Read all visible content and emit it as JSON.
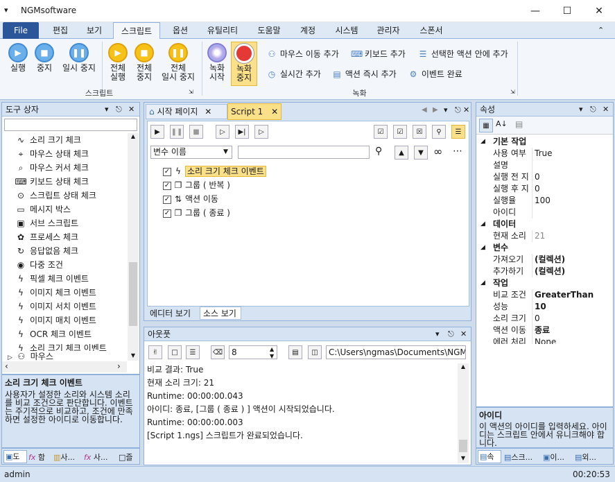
{
  "window": {
    "title": "NGMsoftware",
    "quick_access": "▾"
  },
  "tabs": [
    "File",
    "편집",
    "보기",
    "스크립트",
    "옵션",
    "유틸리티",
    "도움말",
    "계정",
    "시스템",
    "관리자",
    "스폰서"
  ],
  "ribbon": {
    "group_script": "스크립트",
    "group_record": "녹화",
    "run": "실행",
    "stop": "중지",
    "pause": "일시 중지",
    "all_run_1": "전체",
    "all_run_2": "실행",
    "all_stop_1": "전체",
    "all_stop_2": "중지",
    "all_pause_1": "전체",
    "all_pause_2": "일시 중지",
    "rec_start_1": "녹화",
    "rec_start_2": "시작",
    "rec_stop_1": "녹화",
    "rec_stop_2": "중지",
    "add_mouse_move": "마우스 이동 추가",
    "add_keyboard": "키보드 추가",
    "add_in_selected": "선택한 액션 안에 추가",
    "add_realtime": "실시간 추가",
    "add_action_now": "액션 즉시 추가",
    "event_complete": "이벤트 완료"
  },
  "toolbox": {
    "title": "도구 상자",
    "items": [
      {
        "icon": "∿",
        "label": "소리 크기 체크"
      },
      {
        "icon": "⌖",
        "label": "마우스 상태 체크"
      },
      {
        "icon": "⌕",
        "label": "마우스 커서 체크"
      },
      {
        "icon": "⌨",
        "label": "키보드 상태 체크"
      },
      {
        "icon": "⊙",
        "label": "스크립트 상태 체크"
      },
      {
        "icon": "▭",
        "label": "메시지 박스"
      },
      {
        "icon": "▣",
        "label": "서브 스크립트"
      },
      {
        "icon": "✿",
        "label": "프로세스 체크"
      },
      {
        "icon": "↻",
        "label": "응답없음 체크"
      },
      {
        "icon": "◉",
        "label": "다중 조건"
      },
      {
        "icon": "ϟ",
        "label": "픽셀 체크 이벤트"
      },
      {
        "icon": "ϟ",
        "label": "이미지 체크 이벤트"
      },
      {
        "icon": "ϟ",
        "label": "이미지 서치 이벤트"
      },
      {
        "icon": "ϟ",
        "label": "이미지 매치 이벤트"
      },
      {
        "icon": "ϟ",
        "label": "OCR 체크 이벤트"
      },
      {
        "icon": "ϟ",
        "label": "소리 크기 체크 이벤트"
      }
    ],
    "partial_item": "마우스",
    "desc_title": "소리 크기 체크 이벤트",
    "desc_body": "사용자가 설정한 소리와 시스템 소리를 비교 조건으로 판단합니다. 이벤트는 주기적으로 비교하고, 조건에 만족하면 설정한 아이디로 이동합니다.",
    "bottom_tabs": [
      "도",
      "함",
      "사...",
      "사...",
      "즐"
    ]
  },
  "editor": {
    "tab_start": "시작 페이지",
    "tab_script": "Script 1",
    "var_select": "변수 이름",
    "search_value": "",
    "tree": [
      {
        "icon": "ϟ",
        "label": "소리 크기 체크 이벤트",
        "selected": true
      },
      {
        "icon": "❐",
        "label": "그룹 ( 반복 )",
        "selected": false
      },
      {
        "icon": "⇅",
        "label": "액션 이동",
        "selected": false
      },
      {
        "icon": "❐",
        "label": "그룹 ( 종료 )",
        "selected": false
      }
    ],
    "view_editor": "에디터 보기",
    "view_source": "소스 보기"
  },
  "output": {
    "title": "아웃풋",
    "font_size": "8",
    "path": "C:\\Users\\ngmas\\Documents\\NGM6\\",
    "lines": [
      "비교 결과: True",
      "현재 소리 크기: 21",
      "Runtime: 00:00:00.043",
      "아이디: 종료, [그룹 ( 종료 ) ] 액션이 시작되었습니다.",
      "Runtime: 00:00:00.003",
      "[Script 1.ngs] 스크립트가 완료되었습니다."
    ]
  },
  "properties": {
    "title": "속성",
    "rows": [
      {
        "type": "cat",
        "label": "기본 작업"
      },
      {
        "type": "row",
        "key": "사용 여부",
        "value": "True",
        "bold": false
      },
      {
        "type": "row",
        "key": "설명",
        "value": "",
        "bold": false
      },
      {
        "type": "row",
        "key": "실행 전 지",
        "value": "0",
        "bold": false
      },
      {
        "type": "row",
        "key": "실행 후 지",
        "value": "0",
        "bold": false
      },
      {
        "type": "row",
        "key": "실행율",
        "value": "100",
        "bold": false
      },
      {
        "type": "row",
        "key": "아이디",
        "value": "",
        "bold": false
      },
      {
        "type": "cat",
        "label": "데이터"
      },
      {
        "type": "row",
        "key": "현재 소리",
        "value": "21",
        "bold": false,
        "grey": true
      },
      {
        "type": "cat",
        "label": "변수"
      },
      {
        "type": "row",
        "key": "가져오기",
        "value": "(컬렉션)",
        "bold": true
      },
      {
        "type": "row",
        "key": "추가하기",
        "value": "(컬렉션)",
        "bold": true
      },
      {
        "type": "cat",
        "label": "작업"
      },
      {
        "type": "row",
        "key": "비교 조건",
        "value": "GreaterThan",
        "bold": true
      },
      {
        "type": "row",
        "key": "성능",
        "value": "10",
        "bold": true
      },
      {
        "type": "row",
        "key": "소리 크기",
        "value": "0",
        "bold": false
      },
      {
        "type": "row",
        "key": "액션 이동",
        "value": "종료",
        "bold": true
      },
      {
        "type": "row",
        "key": "에러 처리",
        "value": "None",
        "bold": false
      }
    ],
    "desc_title": "아이디",
    "desc_body": "이 액션의 아이디를 입력하세요. 아이디는 스크립트 안에서 유니크해야 합니다.",
    "bottom_tabs": [
      "속",
      "스크...",
      "이...",
      "외..."
    ]
  },
  "status": {
    "user": "admin",
    "time": "00:20:53"
  },
  "colors": {
    "accent": "#2b579a",
    "selection": "#fbe08a"
  }
}
